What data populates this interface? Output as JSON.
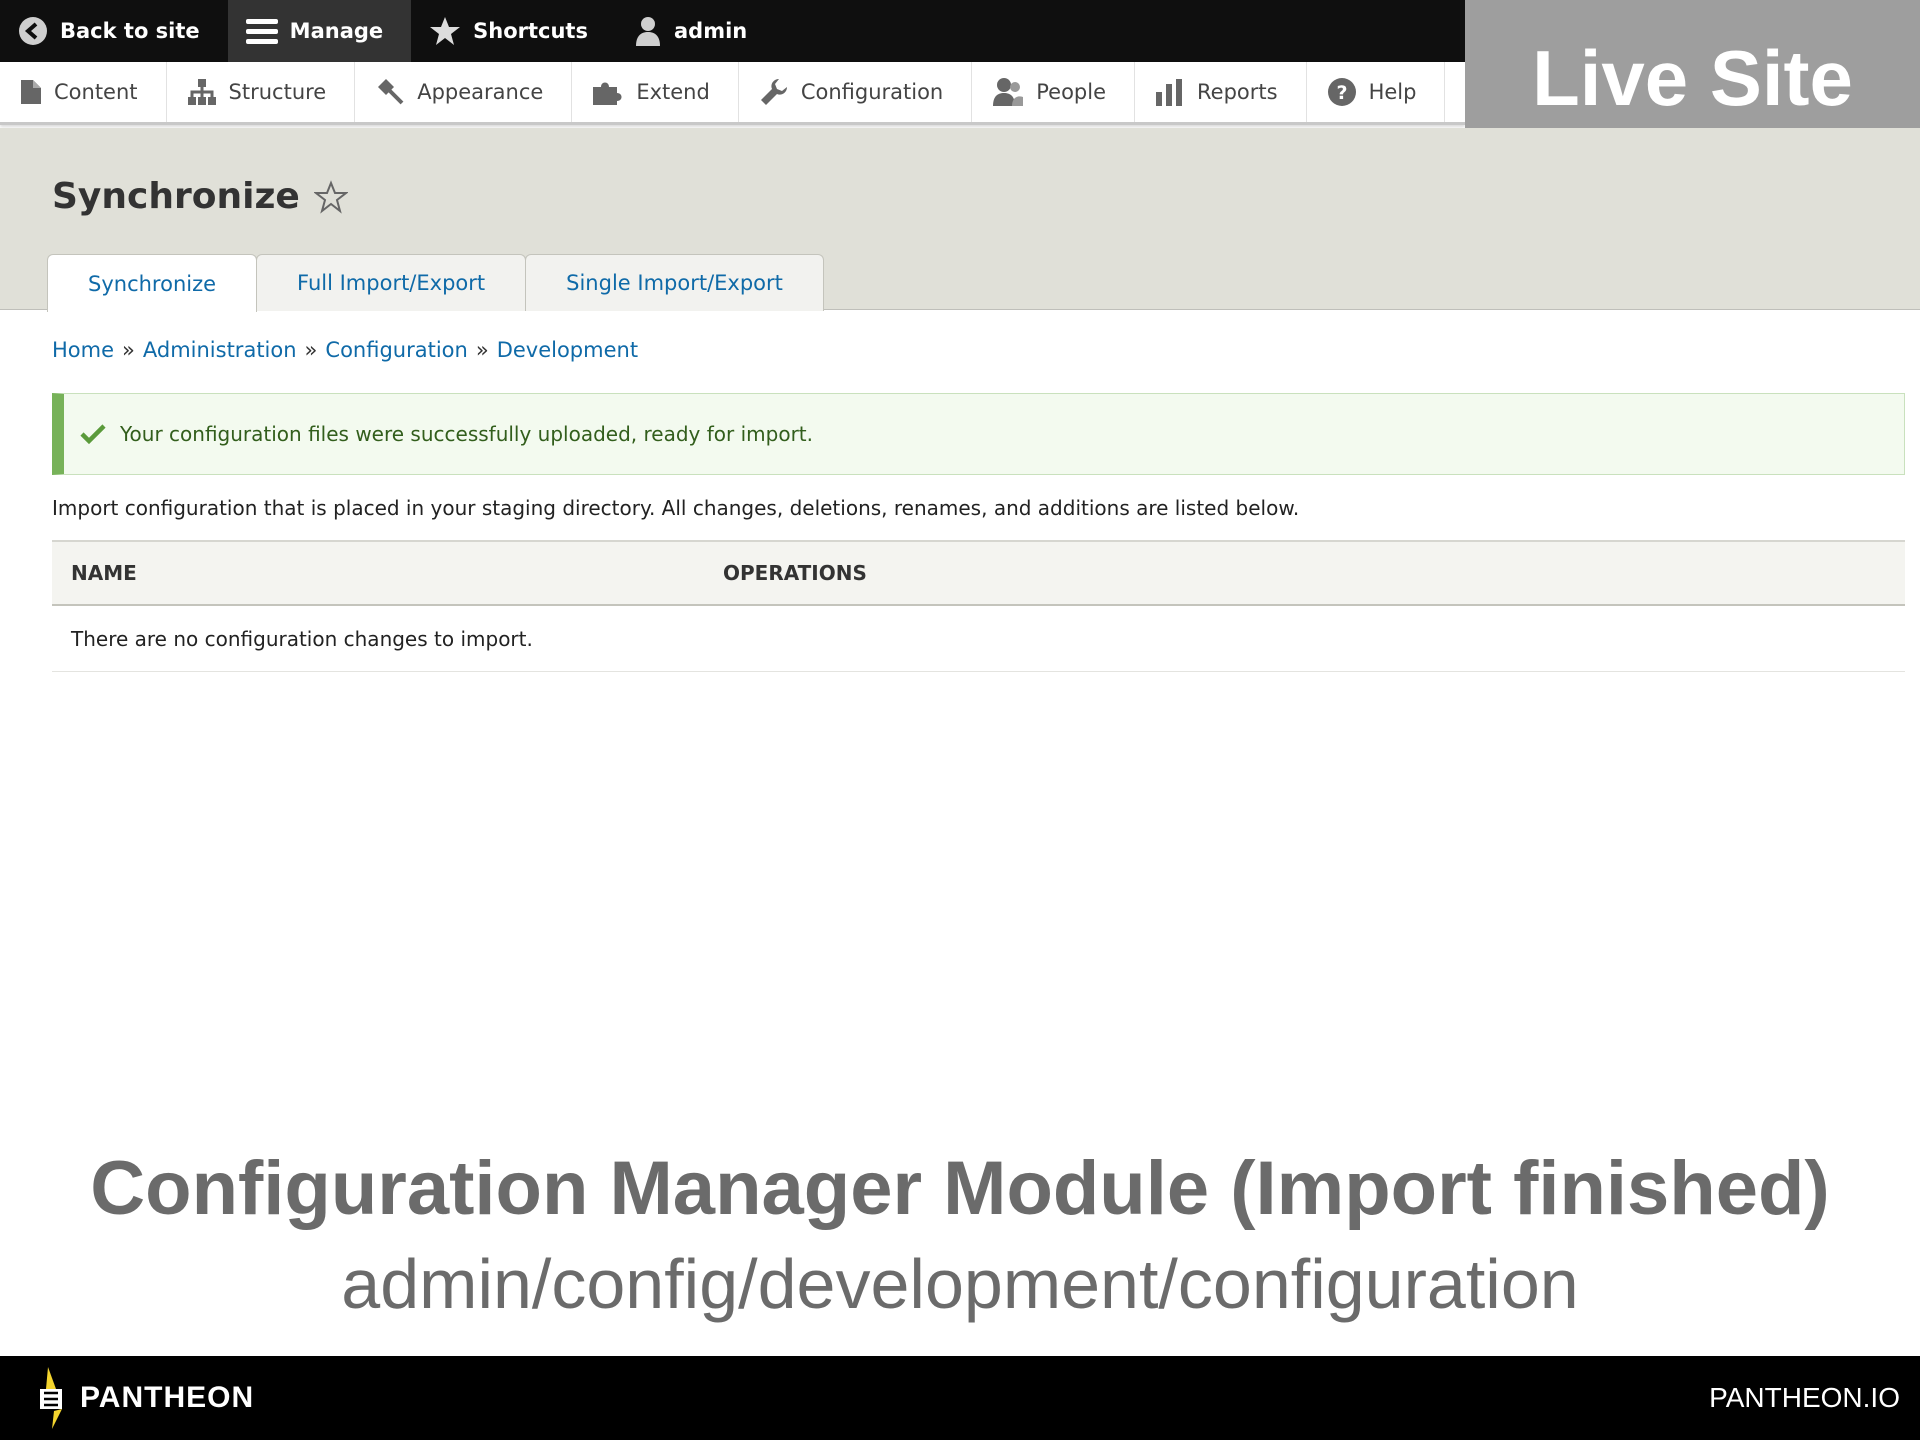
{
  "toolbar": {
    "back_label": "Back to site",
    "manage_label": "Manage",
    "shortcuts_label": "Shortcuts",
    "user_label": "admin"
  },
  "tray": {
    "items": [
      "Content",
      "Structure",
      "Appearance",
      "Extend",
      "Configuration",
      "People",
      "Reports",
      "Help"
    ]
  },
  "badge": {
    "label": "Live Site"
  },
  "page": {
    "title": "Synchronize",
    "tabs": [
      "Synchronize",
      "Full Import/Export",
      "Single Import/Export"
    ]
  },
  "breadcrumb": {
    "items": [
      "Home",
      "Administration",
      "Configuration",
      "Development"
    ],
    "separator": "»"
  },
  "message": {
    "text": "Your configuration files were successfully uploaded, ready for import."
  },
  "description": "Import configuration that is placed in your staging directory. All changes, deletions, renames, and additions are listed below.",
  "table": {
    "headers": [
      "NAME",
      "OPERATIONS"
    ],
    "empty_text": "There are no configuration changes to import."
  },
  "caption": {
    "title": "Configuration Manager Module (Import finished)",
    "subtitle": "admin/config/development/configuration"
  },
  "footer": {
    "brand": "PANTHEON",
    "url": "PANTHEON.IO"
  },
  "colors": {
    "link": "#0f6aa8",
    "toolbar": "#0f0f0f",
    "success": "#77b259",
    "badge": "#9e9e9e"
  }
}
